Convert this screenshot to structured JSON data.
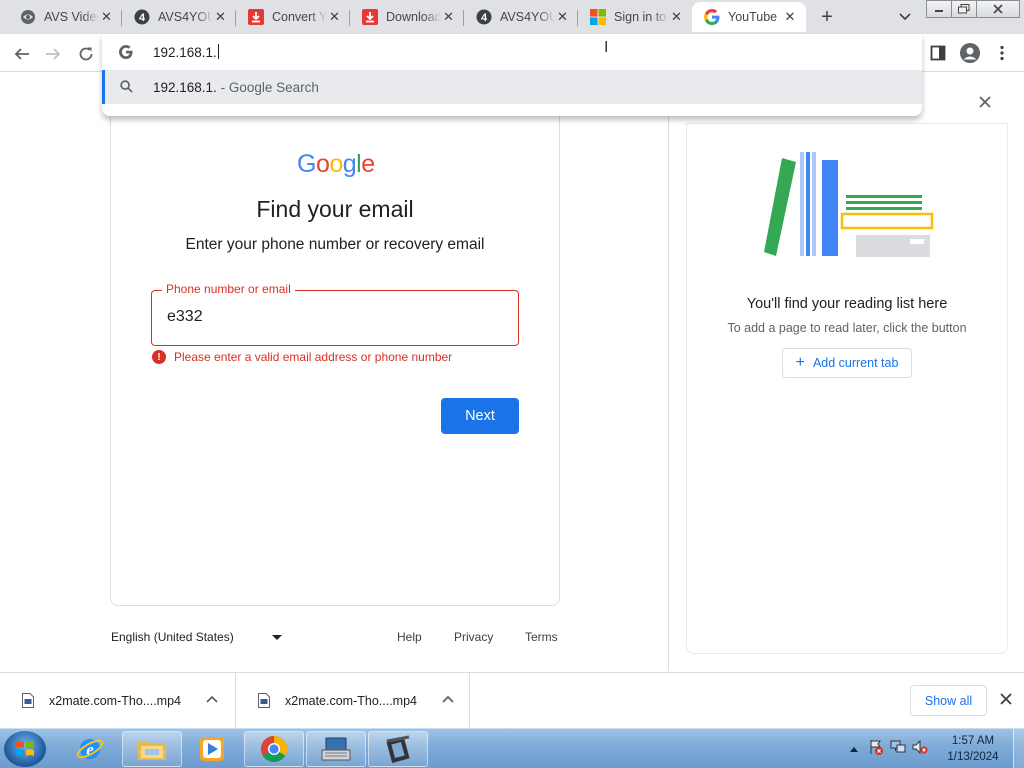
{
  "tabs": [
    {
      "label": "AVS Video",
      "icon": "avs-icon"
    },
    {
      "label": "AVS4YOU",
      "icon": "avs4you-icon"
    },
    {
      "label": "Convert Y",
      "icon": "download-red-icon"
    },
    {
      "label": "Download",
      "icon": "download-red-icon"
    },
    {
      "label": "AVS4YOU",
      "icon": "avs4you-icon"
    },
    {
      "label": "Sign in to",
      "icon": "microsoft-icon"
    },
    {
      "label": "YouTube",
      "icon": "google-g-icon",
      "active": true
    }
  ],
  "omnibox": {
    "input_value": "192.168.1.",
    "suggestion_query": "192.168.1.",
    "suggestion_suffix": "- Google Search"
  },
  "signin": {
    "logo": "Google",
    "title": "Find your email",
    "subtitle": "Enter your phone number or recovery email",
    "field_label": "Phone number or email",
    "field_value": "e332",
    "error": "Please enter a valid email address or phone number",
    "next_label": "Next"
  },
  "footer": {
    "language": "English (United States)",
    "help": "Help",
    "privacy": "Privacy",
    "terms": "Terms"
  },
  "reading_list": {
    "title": "You'll find your reading list here",
    "subtitle": "To add a page to read later, click the button",
    "add_label": "Add current tab"
  },
  "downloads": {
    "items": [
      {
        "name": "x2mate.com-Tho....mp4"
      },
      {
        "name": "x2mate.com-Tho....mp4"
      }
    ],
    "show_all": "Show all"
  },
  "taskbar": {
    "time": "1:57 AM",
    "date": "1/13/2024"
  },
  "colors": {
    "accent": "#1a73e8",
    "error": "#d93025",
    "tabstrip": "#dfe1e5"
  }
}
